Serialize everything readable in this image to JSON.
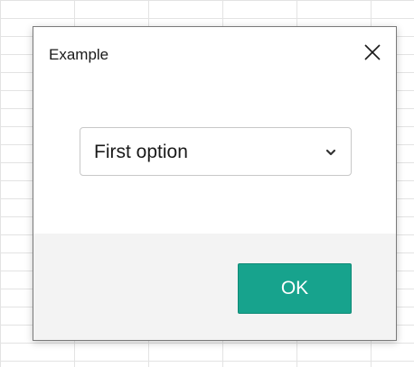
{
  "dialog": {
    "title": "Example",
    "close_icon": "close-icon",
    "select": {
      "value": "First option",
      "icon": "chevron-down-icon"
    },
    "ok_label": "OK"
  },
  "colors": {
    "accent": "#17a38d",
    "footer_bg": "#f3f3f3",
    "grid_line": "#e3e3e3"
  }
}
